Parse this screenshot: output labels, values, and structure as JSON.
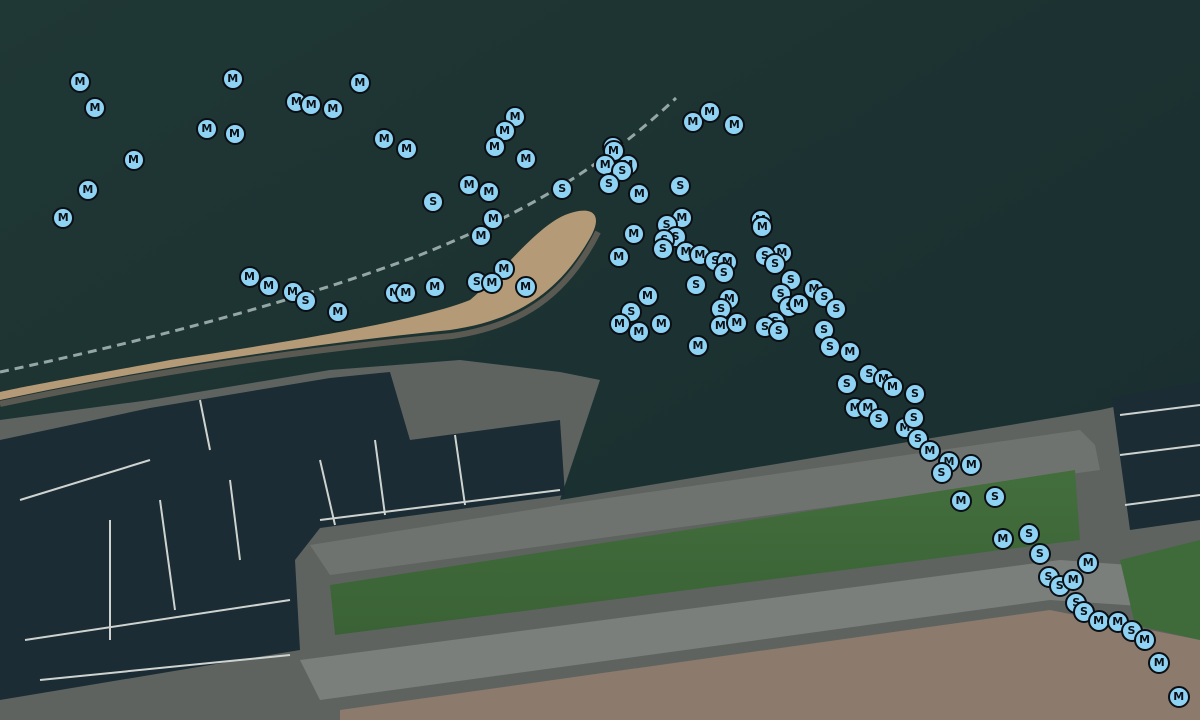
{
  "map": {
    "type": "satellite",
    "colors": {
      "marker_fill": "#8fd3f4",
      "marker_stroke": "#0b0f14",
      "water": "#1e3433",
      "grass": "#3f6b3a"
    }
  },
  "legend_labels": {
    "M": "M",
    "S": "S"
  },
  "markers": [
    {
      "label": "M",
      "lat": 37.80893,
      "lon": -122.44706
    },
    {
      "label": "M",
      "lat": 37.80898,
      "lon": -122.44298
    },
    {
      "label": "M",
      "lat": 37.80892,
      "lon": -122.43958
    },
    {
      "label": "M",
      "lat": 37.80858,
      "lon": -122.44666
    },
    {
      "label": "M",
      "lat": 37.80829,
      "lon": -122.44367
    },
    {
      "label": "M",
      "lat": 37.80822,
      "lon": -122.44293
    },
    {
      "label": "M",
      "lat": 37.80866,
      "lon": -122.44128
    },
    {
      "label": "M",
      "lat": 37.80862,
      "lon": -122.44088
    },
    {
      "label": "M",
      "lat": 37.80856,
      "lon": -122.4403
    },
    {
      "label": "M",
      "lat": 37.80786,
      "lon": -122.44563
    },
    {
      "label": "M",
      "lat": 37.80745,
      "lon": -122.44685
    },
    {
      "label": "M",
      "lat": 37.80707,
      "lon": -122.44751
    },
    {
      "label": "M",
      "lat": 37.80815,
      "lon": -122.43893
    },
    {
      "label": "M",
      "lat": 37.80801,
      "lon": -122.43833
    },
    {
      "label": "S",
      "lat": 37.80728,
      "lon": -122.43762
    },
    {
      "label": "M",
      "lat": 37.80625,
      "lon": -122.44253
    },
    {
      "label": "M",
      "lat": 37.80613,
      "lon": -122.44202
    },
    {
      "label": "M",
      "lat": 37.80605,
      "lon": -122.44138
    },
    {
      "label": "M",
      "lat": 37.80604,
      "lon": -122.43865
    },
    {
      "label": "M",
      "lat": 37.80603,
      "lon": -122.43835
    },
    {
      "label": "M",
      "lat": 37.80612,
      "lon": -122.43758
    },
    {
      "label": "S",
      "lat": 37.80593,
      "lon": -122.44103
    },
    {
      "label": "M",
      "lat": 37.80578,
      "lon": -122.44017
    },
    {
      "label": "M",
      "lat": 37.80846,
      "lon": -122.43543
    },
    {
      "label": "M",
      "lat": 37.80826,
      "lon": -122.43571
    },
    {
      "label": "M",
      "lat": 37.80804,
      "lon": -122.43598
    },
    {
      "label": "M",
      "lat": 37.80787,
      "lon": -122.43514
    },
    {
      "label": "M",
      "lat": 37.80752,
      "lon": -122.43666
    },
    {
      "label": "S",
      "lat": 37.80747,
      "lon": -122.43417
    },
    {
      "label": "M",
      "lat": 37.80742,
      "lon": -122.43613
    },
    {
      "label": "M",
      "lat": 37.80705,
      "lon": -122.43601
    },
    {
      "label": "M",
      "lat": 37.80682,
      "lon": -122.43634
    },
    {
      "label": "M",
      "lat": 37.80637,
      "lon": -122.43573
    },
    {
      "label": "S",
      "lat": 37.80619,
      "lon": -122.43645
    },
    {
      "label": "M",
      "lat": 37.80617,
      "lon": -122.43605
    },
    {
      "label": "M",
      "lat": 37.80612,
      "lon": -122.43515
    },
    {
      "label": "M",
      "lat": 37.80804,
      "lon": -122.43282
    },
    {
      "label": "M",
      "lat": 37.80798,
      "lon": -122.4328
    },
    {
      "label": "M",
      "lat": 37.8078,
      "lon": -122.43302
    },
    {
      "label": "M",
      "lat": 37.80779,
      "lon": -122.43242
    },
    {
      "label": "S",
      "lat": 37.80771,
      "lon": -122.43256
    },
    {
      "label": "S",
      "lat": 37.80753,
      "lon": -122.43292
    },
    {
      "label": "M",
      "lat": 37.80739,
      "lon": -122.43211
    },
    {
      "label": "M",
      "lat": 37.80684,
      "lon": -122.43226
    },
    {
      "label": "M",
      "lat": 37.80653,
      "lon": -122.43266
    },
    {
      "label": "M",
      "lat": 37.80599,
      "lon": -122.43189
    },
    {
      "label": "S",
      "lat": 37.80577,
      "lon": -122.43232
    },
    {
      "label": "M",
      "lat": 37.80561,
      "lon": -122.43264
    },
    {
      "label": "M",
      "lat": 37.80561,
      "lon": -122.43152
    },
    {
      "label": "M",
      "lat": 37.8055,
      "lon": -122.43212
    },
    {
      "label": "M",
      "lat": 37.80838,
      "lon": -122.43068
    },
    {
      "label": "M",
      "lat": 37.80852,
      "lon": -122.43023
    },
    {
      "label": "M",
      "lat": 37.80834,
      "lon": -122.42957
    },
    {
      "label": "S",
      "lat": 37.80751,
      "lon": -122.43101
    },
    {
      "label": "M",
      "lat": 37.80707,
      "lon": -122.43097
    },
    {
      "label": "S",
      "lat": 37.80697,
      "lon": -122.43138
    },
    {
      "label": "S",
      "lat": 37.80681,
      "lon": -122.43114
    },
    {
      "label": "S",
      "lat": 37.80676,
      "lon": -122.43144
    },
    {
      "label": "S",
      "lat": 37.80664,
      "lon": -122.43148
    },
    {
      "label": "M",
      "lat": 37.8066,
      "lon": -122.43086
    },
    {
      "label": "M",
      "lat": 37.80656,
      "lon": -122.43049
    },
    {
      "label": "S",
      "lat": 37.80648,
      "lon": -122.43008
    },
    {
      "label": "M",
      "lat": 37.80646,
      "lon": -122.42976
    },
    {
      "label": "S",
      "lat": 37.80631,
      "lon": -122.42985
    },
    {
      "label": "S",
      "lat": 37.80614,
      "lon": -122.43059
    },
    {
      "label": "M",
      "lat": 37.80596,
      "lon": -122.4297
    },
    {
      "label": "S",
      "lat": 37.80582,
      "lon": -122.42992
    },
    {
      "label": "M",
      "lat": 37.80558,
      "lon": -122.42994
    },
    {
      "label": "M",
      "lat": 37.80563,
      "lon": -122.4295
    },
    {
      "label": "M",
      "lat": 37.80531,
      "lon": -122.43054
    },
    {
      "label": "M",
      "lat": 37.80704,
      "lon": -122.42887
    },
    {
      "label": "M",
      "lat": 37.80694,
      "lon": -122.42882
    },
    {
      "label": "M",
      "lat": 37.80658,
      "lon": -122.4283
    },
    {
      "label": "S",
      "lat": 37.80654,
      "lon": -122.42875
    },
    {
      "label": "S",
      "lat": 37.80643,
      "lon": -122.42848
    },
    {
      "label": "S",
      "lat": 37.80621,
      "lon": -122.42806
    },
    {
      "label": "S",
      "lat": 37.80602,
      "lon": -122.42833
    },
    {
      "label": "S",
      "lat": 37.80585,
      "lon": -122.4281
    },
    {
      "label": "S",
      "lat": 37.80564,
      "lon": -122.42848
    },
    {
      "label": "S",
      "lat": 37.80557,
      "lon": -122.42875
    },
    {
      "label": "S",
      "lat": 37.80551,
      "lon": -122.42838
    },
    {
      "label": "M",
      "lat": 37.80589,
      "lon": -122.42785
    },
    {
      "label": "M",
      "lat": 37.80609,
      "lon": -122.42744
    },
    {
      "label": "S",
      "lat": 37.80598,
      "lon": -122.42716
    },
    {
      "label": "S",
      "lat": 37.80581,
      "lon": -122.42684
    },
    {
      "label": "S",
      "lat": 37.80553,
      "lon": -122.42717
    },
    {
      "label": "S",
      "lat": 37.80529,
      "lon": -122.42701
    },
    {
      "label": "M",
      "lat": 37.80522,
      "lon": -122.42648
    },
    {
      "label": "S",
      "lat": 37.80493,
      "lon": -122.42596
    },
    {
      "label": "M",
      "lat": 37.80486,
      "lon": -122.42558
    },
    {
      "label": "S",
      "lat": 37.80479,
      "lon": -122.42656
    },
    {
      "label": "M",
      "lat": 37.80446,
      "lon": -122.42634
    },
    {
      "label": "M",
      "lat": 37.80446,
      "lon": -122.426
    },
    {
      "label": "S",
      "lat": 37.80431,
      "lon": -122.42571
    },
    {
      "label": "M",
      "lat": 37.80475,
      "lon": -122.42534
    },
    {
      "label": "M",
      "lat": 37.80418,
      "lon": -122.42501
    },
    {
      "label": "S",
      "lat": 37.80465,
      "lon": -122.42474
    },
    {
      "label": "S",
      "lat": 37.80432,
      "lon": -122.42477
    },
    {
      "label": "S",
      "lat": 37.80403,
      "lon": -122.42466
    },
    {
      "label": "M",
      "lat": 37.80387,
      "lon": -122.42434
    },
    {
      "label": "M",
      "lat": 37.80371,
      "lon": -122.42383
    },
    {
      "label": "S",
      "lat": 37.80356,
      "lon": -122.42403
    },
    {
      "label": "M",
      "lat": 37.80367,
      "lon": -122.42323
    },
    {
      "label": "M",
      "lat": 37.80318,
      "lon": -122.42351
    },
    {
      "label": "S",
      "lat": 37.80323,
      "lon": -122.4226
    },
    {
      "label": "M",
      "lat": 37.80266,
      "lon": -122.42239
    },
    {
      "label": "S",
      "lat": 37.80273,
      "lon": -122.42169
    },
    {
      "label": "S",
      "lat": 37.80245,
      "lon": -122.4214
    },
    {
      "label": "S",
      "lat": 37.80213,
      "lon": -122.42117
    },
    {
      "label": "S",
      "lat": 37.80201,
      "lon": -122.42087
    },
    {
      "label": "M",
      "lat": 37.8021,
      "lon": -122.42051
    },
    {
      "label": "M",
      "lat": 37.80233,
      "lon": -122.42011
    },
    {
      "label": "S",
      "lat": 37.80178,
      "lon": -122.42043
    },
    {
      "label": "S",
      "lat": 37.80166,
      "lon": -122.42022
    },
    {
      "label": "M",
      "lat": 37.80153,
      "lon": -122.41983
    },
    {
      "label": "M",
      "lat": 37.80152,
      "lon": -122.41932
    },
    {
      "label": "S",
      "lat": 37.80139,
      "lon": -122.41895
    },
    {
      "label": "M",
      "lat": 37.80127,
      "lon": -122.4186
    },
    {
      "label": "M",
      "lat": 37.80095,
      "lon": -122.41821
    },
    {
      "label": "M",
      "lat": 37.80048,
      "lon": -122.41769
    }
  ]
}
